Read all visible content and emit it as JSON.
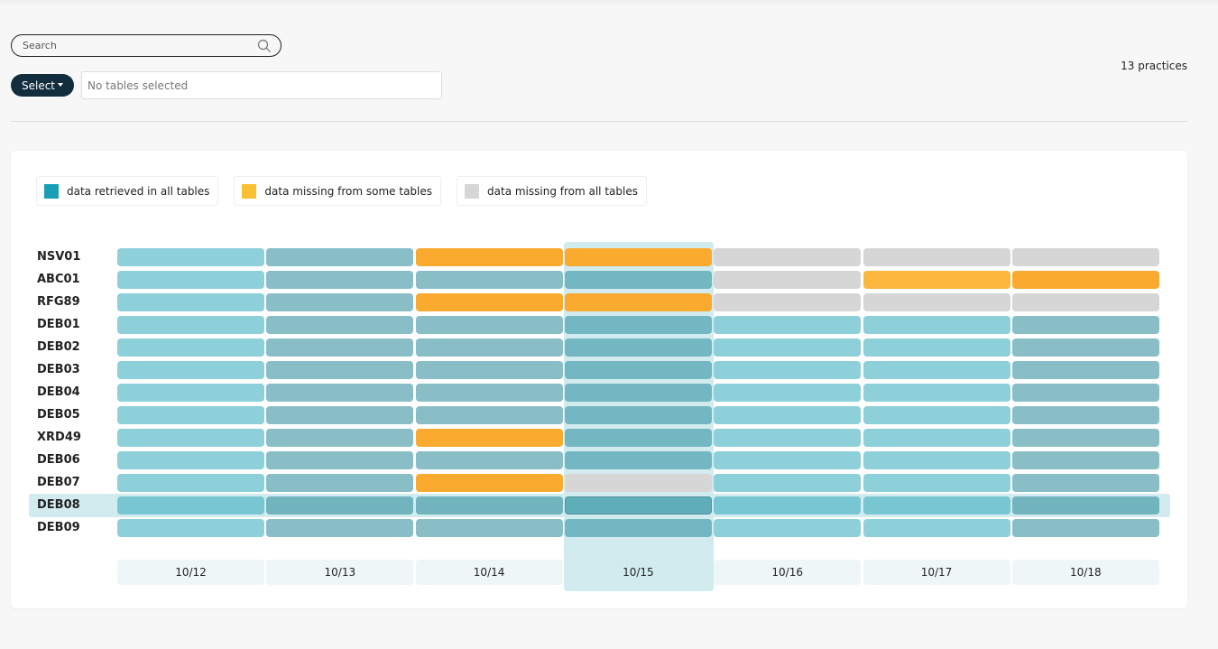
{
  "search": {
    "placeholder": "Search",
    "value": ""
  },
  "select_button": {
    "label": "Select"
  },
  "tables_field": {
    "text": "No tables selected"
  },
  "practices_count": "13 practices",
  "legend": [
    {
      "label": "data retrieved in all tables",
      "color": "#189fb5",
      "status": "ok"
    },
    {
      "label": "data missing from some tables",
      "color": "#fbbf32",
      "status": "partial"
    },
    {
      "label": "data missing from all tables",
      "color": "#d6d6d6",
      "status": "missing"
    }
  ],
  "colors": {
    "col_highlight": "#d2ebef",
    "ok_light": "#8dd0da",
    "ok_muted": "#89bec7",
    "ok_active_col": "#73b7c2",
    "ok_hover_row_light": "#77c6d2",
    "ok_hover_row_muted": "#72b4bd",
    "ok_hover_cell": "#5eadb9",
    "partial": "#f9aa2f",
    "partial_alt": "#fdb73e",
    "missing": "#d6d6d6"
  },
  "chart_data": {
    "type": "heatmap",
    "title": "",
    "x": [
      "10/12",
      "10/13",
      "10/14",
      "10/15",
      "10/16",
      "10/17",
      "10/18"
    ],
    "y": [
      "NSV01",
      "ABC01",
      "RFG89",
      "DEB01",
      "DEB02",
      "DEB03",
      "DEB04",
      "DEB05",
      "XRD49",
      "DEB06",
      "DEB07",
      "DEB08",
      "DEB09"
    ],
    "legend_placement": "top-left",
    "values": [
      [
        "ok",
        "ok",
        "partial",
        "partial",
        "missing",
        "missing",
        "missing"
      ],
      [
        "ok",
        "ok",
        "ok",
        "ok",
        "missing",
        "partial",
        "partial"
      ],
      [
        "ok",
        "ok",
        "partial",
        "partial",
        "missing",
        "missing",
        "missing"
      ],
      [
        "ok",
        "ok",
        "ok",
        "ok",
        "ok",
        "ok",
        "ok"
      ],
      [
        "ok",
        "ok",
        "ok",
        "ok",
        "ok",
        "ok",
        "ok"
      ],
      [
        "ok",
        "ok",
        "ok",
        "ok",
        "ok",
        "ok",
        "ok"
      ],
      [
        "ok",
        "ok",
        "ok",
        "ok",
        "ok",
        "ok",
        "ok"
      ],
      [
        "ok",
        "ok",
        "ok",
        "ok",
        "ok",
        "ok",
        "ok"
      ],
      [
        "ok",
        "ok",
        "partial",
        "ok",
        "ok",
        "ok",
        "ok"
      ],
      [
        "ok",
        "ok",
        "ok",
        "ok",
        "ok",
        "ok",
        "ok"
      ],
      [
        "ok",
        "ok",
        "partial",
        "missing",
        "ok",
        "ok",
        "ok"
      ],
      [
        "ok",
        "ok",
        "ok",
        "ok",
        "ok",
        "ok",
        "ok"
      ],
      [
        "ok",
        "ok",
        "ok",
        "ok",
        "ok",
        "ok",
        "ok"
      ]
    ],
    "column_shade": [
      "light",
      "muted",
      "muted",
      "active",
      "light",
      "light",
      "muted"
    ],
    "highlighted_column": "10/15",
    "highlighted_row": "DEB08"
  }
}
